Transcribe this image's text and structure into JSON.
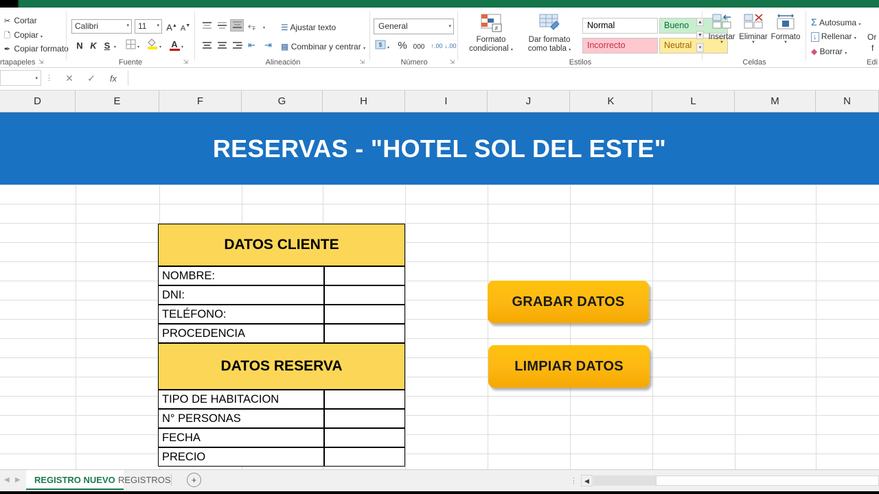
{
  "app": {
    "name": "Microsoft Excel",
    "accent_green": "#14744a",
    "banner_blue": "#1a72c2",
    "header_yellow": "#fcd757",
    "button_amber": "#ffc20e"
  },
  "ribbon": {
    "clipboard": {
      "label": "rtapapeles",
      "items": [
        {
          "icon": "scissors-icon",
          "label": "Cortar",
          "glyph": "✂"
        },
        {
          "icon": "copy-icon",
          "label": "Copiar",
          "glyph": "❐",
          "caret": "▾"
        },
        {
          "icon": "format-painter-icon",
          "label": "Copiar formato",
          "glyph": "✒"
        }
      ]
    },
    "font": {
      "label": "Fuente",
      "family_value": "Calibri",
      "size_value": "11",
      "grow_label": "A",
      "shrink_label": "A",
      "bold_label": "N",
      "italic_label": "K",
      "underline_label": "S",
      "borders_icon": "borders-icon",
      "fill_icon": "fill-color-icon",
      "font_color_icon": "font-color-icon",
      "font_color_letter": "A",
      "caret": "▾"
    },
    "alignment": {
      "label": "Alineación",
      "wrap_text_label": "Ajustar texto",
      "merge_center_label": "Combinar y centrar",
      "orientation_icon": "orientation-icon",
      "decrease_indent_icon": "decrease-indent-icon",
      "increase_indent_icon": "increase-indent-icon",
      "caret": "▾"
    },
    "number": {
      "label": "Número",
      "format_value": "General",
      "accounting_icon": "accounting-format-icon",
      "percent_label": "%",
      "thousands_label": "000",
      "increase_decimal_label": "\u0000",
      "decrease_decimal_label": "\u0000",
      "caret": "▾"
    },
    "styles": {
      "label": "Estilos",
      "conditional_label_line1": "Formato",
      "conditional_label_line2": "condicional",
      "table_label_line1": "Dar formato",
      "table_label_line2": "como tabla",
      "gallery": [
        {
          "name": "Normal",
          "bg": "#ffffff",
          "fg": "#000000"
        },
        {
          "name": "Bueno",
          "bg": "#c6efce",
          "fg": "#0f6b3a"
        },
        {
          "name": "Incorrecto",
          "bg": "#ffc7ce",
          "fg": "#c0304a"
        },
        {
          "name": "Neutral",
          "bg": "#ffeb9c",
          "fg": "#9c6500"
        }
      ],
      "caret": "▾"
    },
    "cells": {
      "label": "Celdas",
      "items": [
        {
          "label": "Insertar",
          "icon": "insert-cells-icon"
        },
        {
          "label": "Eliminar",
          "icon": "delete-cells-icon"
        },
        {
          "label": "Formato",
          "icon": "format-cells-icon"
        }
      ],
      "caret": "▾"
    },
    "editing": {
      "label_line1": "Or",
      "label_line2": "f",
      "label": "Edi",
      "items": [
        {
          "label": "Autosuma",
          "icon": "sum-icon",
          "glyph": "Σ",
          "caret": "▾"
        },
        {
          "label": "Rellenar",
          "icon": "fill-down-icon",
          "glyph": "↓",
          "caret": "▾"
        },
        {
          "label": "Borrar",
          "icon": "eraser-icon",
          "glyph": "◆",
          "caret": "▾"
        }
      ]
    }
  },
  "formula_bar": {
    "name_box_value": "",
    "name_box_caret": "▾",
    "grip_icon": "drag-grip-icon",
    "cancel_icon": "cancel-icon",
    "cancel_glyph": "✕",
    "accept_icon": "accept-icon",
    "accept_glyph": "✓",
    "function_icon": "insert-function-icon",
    "function_glyph": "fx",
    "input_value": ""
  },
  "sheet": {
    "column_headers": [
      "D",
      "E",
      "F",
      "G",
      "H",
      "I",
      "J",
      "K",
      "L",
      "M",
      "N"
    ],
    "banner_title": "RESERVAS - \"HOTEL SOL DEL ESTE\"",
    "sections": [
      {
        "title": "DATOS CLIENTE",
        "rows": [
          {
            "label": "NOMBRE:",
            "value": ""
          },
          {
            "label": "DNI:",
            "value": ""
          },
          {
            "label": "TELÉFONO:",
            "value": ""
          },
          {
            "label": "PROCEDENCIA",
            "value": ""
          }
        ]
      },
      {
        "title": "DATOS RESERVA",
        "rows": [
          {
            "label": "TIPO DE HABITACION",
            "value": ""
          },
          {
            "label": "N° PERSONAS",
            "value": ""
          },
          {
            "label": "FECHA",
            "value": ""
          },
          {
            "label": "PRECIO",
            "value": ""
          }
        ]
      }
    ],
    "buttons": [
      {
        "label": "GRABAR DATOS",
        "name": "grabar-datos-button"
      },
      {
        "label": "LIMPIAR DATOS",
        "name": "limpiar-datos-button"
      }
    ]
  },
  "tabbar": {
    "nav_prev_glyph": "◀",
    "nav_next_glyph": "▶",
    "tabs": [
      {
        "label": "REGISTRO NUEVO",
        "active": true
      },
      {
        "label": "REGISTROS",
        "active": false
      }
    ],
    "add_sheet_glyph": "⊕",
    "scroll_left_glyph": "◀"
  }
}
